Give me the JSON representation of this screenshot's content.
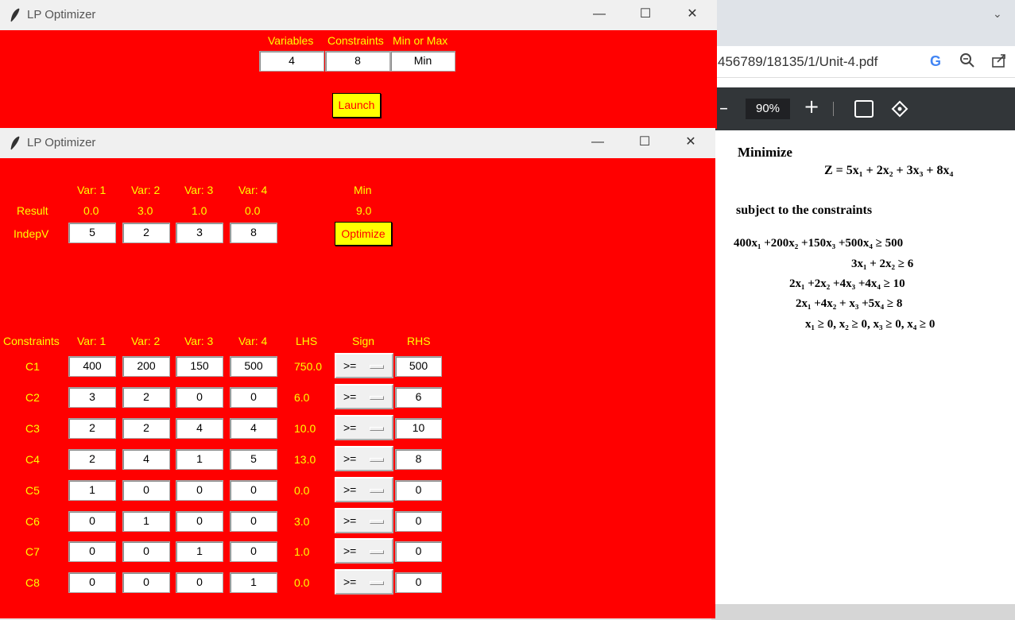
{
  "browser": {
    "url": "456789/18135/1/Unit-4.pdf",
    "zoom": "90%",
    "pdf": {
      "heading1": "Minimize",
      "objective": "Z = 5x₁ + 2x₂ + 3x₃ + 8x₄",
      "heading2": "subject to the constraints",
      "constraints": [
        "400x₁ +200x₂ +150x₃ +500x₄   ≥  500",
        "3x₁ + 2x₂   ≥    6",
        "2x₁ +2x₂ +4x₃ +4x₄   ≥   10",
        "2x₁ +4x₂ + x₃ +5x₄   ≥    8",
        "x₁ ≥ 0, x₂ ≥ 0, x₃ ≥ 0, x₄ ≥ 0"
      ]
    }
  },
  "win1": {
    "title": "LP Optimizer",
    "headers": [
      "Variables",
      "Constraints",
      "Min or Max"
    ],
    "values": [
      "4",
      "8",
      "Min"
    ],
    "launch": "Launch"
  },
  "win2": {
    "title": "LP Optimizer",
    "var_headers": [
      "Var: 1",
      "Var: 2",
      "Var: 3",
      "Var: 4"
    ],
    "mode": "Min",
    "result_label": "Result",
    "results": [
      "0.0",
      "3.0",
      "1.0",
      "0.0"
    ],
    "objective_value": "9.0",
    "indep_label": "IndepV",
    "indep": [
      "5",
      "2",
      "3",
      "8"
    ],
    "optimize": "Optimize",
    "constraints_label": "Constraints",
    "lhs_label": "LHS",
    "sign_label": "Sign",
    "rhs_label": "RHS",
    "rows": [
      {
        "name": "C1",
        "coef": [
          "400",
          "200",
          "150",
          "500"
        ],
        "lhs": "750.0",
        "sign": ">=",
        "rhs": "500"
      },
      {
        "name": "C2",
        "coef": [
          "3",
          "2",
          "0",
          "0"
        ],
        "lhs": "6.0",
        "sign": ">=",
        "rhs": "6"
      },
      {
        "name": "C3",
        "coef": [
          "2",
          "2",
          "4",
          "4"
        ],
        "lhs": "10.0",
        "sign": ">=",
        "rhs": "10"
      },
      {
        "name": "C4",
        "coef": [
          "2",
          "4",
          "1",
          "5"
        ],
        "lhs": "13.0",
        "sign": ">=",
        "rhs": "8"
      },
      {
        "name": "C5",
        "coef": [
          "1",
          "0",
          "0",
          "0"
        ],
        "lhs": "0.0",
        "sign": ">=",
        "rhs": "0"
      },
      {
        "name": "C6",
        "coef": [
          "0",
          "1",
          "0",
          "0"
        ],
        "lhs": "3.0",
        "sign": ">=",
        "rhs": "0"
      },
      {
        "name": "C7",
        "coef": [
          "0",
          "0",
          "1",
          "0"
        ],
        "lhs": "1.0",
        "sign": ">=",
        "rhs": "0"
      },
      {
        "name": "C8",
        "coef": [
          "0",
          "0",
          "0",
          "1"
        ],
        "lhs": "0.0",
        "sign": ">=",
        "rhs": "0"
      }
    ]
  },
  "colors": {
    "window_bg": "#ff0000",
    "label": "#ffff00",
    "button_bg": "#ffff00"
  },
  "icons": [
    "feather-icon",
    "minimize-icon",
    "maximize-icon",
    "close-icon",
    "google-icon",
    "zoom-icon",
    "share-icon",
    "fit-page-icon",
    "rotate-icon",
    "chevron-down-icon"
  ]
}
